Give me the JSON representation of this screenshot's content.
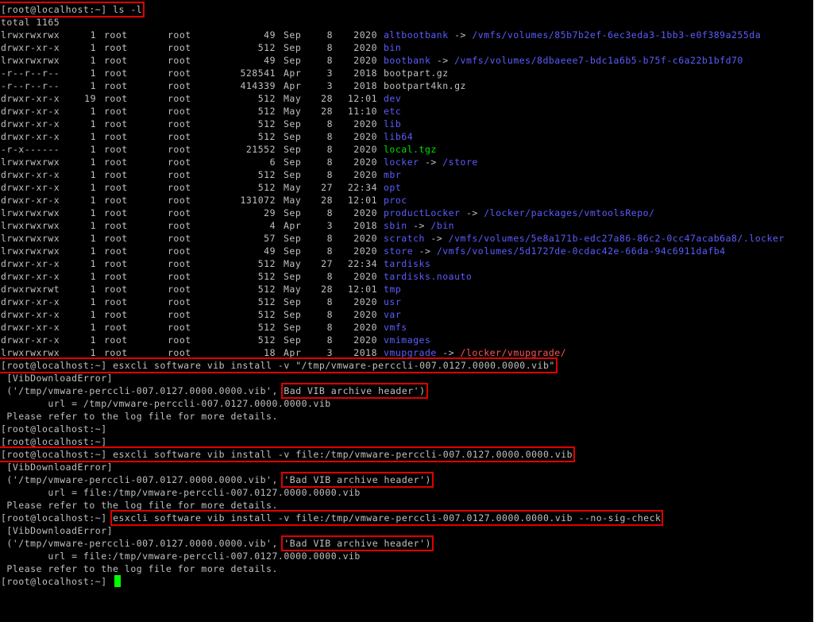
{
  "terminal": {
    "prompt": "[root@localhost:~]",
    "cmd_ls": "ls -l",
    "total": "total 1165",
    "listing": [
      {
        "perm": "lrwxrwxrwx",
        "links": "1",
        "owner": "root",
        "group": "root",
        "size": "49",
        "month": "Sep",
        "day": "8",
        "time": "2020",
        "name": "altbootbank",
        "kind": "link",
        "target": "/vmfs/volumes/85b7b2ef-6ec3eda3-1bb3-e0f389a255da",
        "target_kind": "dir"
      },
      {
        "perm": "drwxr-xr-x",
        "links": "1",
        "owner": "root",
        "group": "root",
        "size": "512",
        "month": "Sep",
        "day": "8",
        "time": "2020",
        "name": "bin",
        "kind": "dir",
        "target": "",
        "target_kind": ""
      },
      {
        "perm": "lrwxrwxrwx",
        "links": "1",
        "owner": "root",
        "group": "root",
        "size": "49",
        "month": "Sep",
        "day": "8",
        "time": "2020",
        "name": "bootbank",
        "kind": "link",
        "target": "/vmfs/volumes/8dbaeee7-bdc1a6b5-b75f-c6a22b1bfd70",
        "target_kind": "dir"
      },
      {
        "perm": "-r--r--r--",
        "links": "1",
        "owner": "root",
        "group": "root",
        "size": "528541",
        "month": "Apr",
        "day": "3",
        "time": "2018",
        "name": "bootpart.gz",
        "kind": "file",
        "target": "",
        "target_kind": ""
      },
      {
        "perm": "-r--r--r--",
        "links": "1",
        "owner": "root",
        "group": "root",
        "size": "414339",
        "month": "Apr",
        "day": "3",
        "time": "2018",
        "name": "bootpart4kn.gz",
        "kind": "file",
        "target": "",
        "target_kind": ""
      },
      {
        "perm": "drwxr-xr-x",
        "links": "19",
        "owner": "root",
        "group": "root",
        "size": "512",
        "month": "May",
        "day": "28",
        "time": "12:01",
        "name": "dev",
        "kind": "dir",
        "target": "",
        "target_kind": ""
      },
      {
        "perm": "drwxr-xr-x",
        "links": "1",
        "owner": "root",
        "group": "root",
        "size": "512",
        "month": "May",
        "day": "28",
        "time": "11:10",
        "name": "etc",
        "kind": "dir",
        "target": "",
        "target_kind": ""
      },
      {
        "perm": "drwxr-xr-x",
        "links": "1",
        "owner": "root",
        "group": "root",
        "size": "512",
        "month": "Sep",
        "day": "8",
        "time": "2020",
        "name": "lib",
        "kind": "dir",
        "target": "",
        "target_kind": ""
      },
      {
        "perm": "drwxr-xr-x",
        "links": "1",
        "owner": "root",
        "group": "root",
        "size": "512",
        "month": "Sep",
        "day": "8",
        "time": "2020",
        "name": "lib64",
        "kind": "dir",
        "target": "",
        "target_kind": ""
      },
      {
        "perm": "-r-x------",
        "links": "1",
        "owner": "root",
        "group": "root",
        "size": "21552",
        "month": "Sep",
        "day": "8",
        "time": "2020",
        "name": "local.tgz",
        "kind": "exec",
        "target": "",
        "target_kind": ""
      },
      {
        "perm": "lrwxrwxrwx",
        "links": "1",
        "owner": "root",
        "group": "root",
        "size": "6",
        "month": "Sep",
        "day": "8",
        "time": "2020",
        "name": "locker",
        "kind": "link",
        "target": "/store",
        "target_kind": "dir"
      },
      {
        "perm": "drwxr-xr-x",
        "links": "1",
        "owner": "root",
        "group": "root",
        "size": "512",
        "month": "Sep",
        "day": "8",
        "time": "2020",
        "name": "mbr",
        "kind": "dir",
        "target": "",
        "target_kind": ""
      },
      {
        "perm": "drwxr-xr-x",
        "links": "1",
        "owner": "root",
        "group": "root",
        "size": "512",
        "month": "May",
        "day": "27",
        "time": "22:34",
        "name": "opt",
        "kind": "dir",
        "target": "",
        "target_kind": ""
      },
      {
        "perm": "drwxr-xr-x",
        "links": "1",
        "owner": "root",
        "group": "root",
        "size": "131072",
        "month": "May",
        "day": "28",
        "time": "12:01",
        "name": "proc",
        "kind": "dir",
        "target": "",
        "target_kind": ""
      },
      {
        "perm": "lrwxrwxrwx",
        "links": "1",
        "owner": "root",
        "group": "root",
        "size": "29",
        "month": "Sep",
        "day": "8",
        "time": "2020",
        "name": "productLocker",
        "kind": "link",
        "target": "/locker/packages/vmtoolsRepo/",
        "target_kind": "dir"
      },
      {
        "perm": "lrwxrwxrwx",
        "links": "1",
        "owner": "root",
        "group": "root",
        "size": "4",
        "month": "Apr",
        "day": "3",
        "time": "2018",
        "name": "sbin",
        "kind": "link",
        "target": "/bin",
        "target_kind": "dir"
      },
      {
        "perm": "lrwxrwxrwx",
        "links": "1",
        "owner": "root",
        "group": "root",
        "size": "57",
        "month": "Sep",
        "day": "8",
        "time": "2020",
        "name": "scratch",
        "kind": "link",
        "target": "/vmfs/volumes/5e8a171b-edc27a86-86c2-0cc47acab6a8/.locker",
        "target_kind": "dir"
      },
      {
        "perm": "lrwxrwxrwx",
        "links": "1",
        "owner": "root",
        "group": "root",
        "size": "49",
        "month": "Sep",
        "day": "8",
        "time": "2020",
        "name": "store",
        "kind": "link",
        "target": "/vmfs/volumes/5d1727de-0cdac42e-66da-94c6911dafb4",
        "target_kind": "dir"
      },
      {
        "perm": "drwxr-xr-x",
        "links": "1",
        "owner": "root",
        "group": "root",
        "size": "512",
        "month": "May",
        "day": "27",
        "time": "22:34",
        "name": "tardisks",
        "kind": "dir",
        "target": "",
        "target_kind": ""
      },
      {
        "perm": "drwxr-xr-x",
        "links": "1",
        "owner": "root",
        "group": "root",
        "size": "512",
        "month": "Sep",
        "day": "8",
        "time": "2020",
        "name": "tardisks.noauto",
        "kind": "dir",
        "target": "",
        "target_kind": ""
      },
      {
        "perm": "drwxrwxrwt",
        "links": "1",
        "owner": "root",
        "group": "root",
        "size": "512",
        "month": "May",
        "day": "28",
        "time": "12:01",
        "name": "tmp",
        "kind": "dir",
        "target": "",
        "target_kind": ""
      },
      {
        "perm": "drwxr-xr-x",
        "links": "1",
        "owner": "root",
        "group": "root",
        "size": "512",
        "month": "Sep",
        "day": "8",
        "time": "2020",
        "name": "usr",
        "kind": "dir",
        "target": "",
        "target_kind": ""
      },
      {
        "perm": "drwxr-xr-x",
        "links": "1",
        "owner": "root",
        "group": "root",
        "size": "512",
        "month": "Sep",
        "day": "8",
        "time": "2020",
        "name": "var",
        "kind": "dir",
        "target": "",
        "target_kind": ""
      },
      {
        "perm": "drwxr-xr-x",
        "links": "1",
        "owner": "root",
        "group": "root",
        "size": "512",
        "month": "Sep",
        "day": "8",
        "time": "2020",
        "name": "vmfs",
        "kind": "dir",
        "target": "",
        "target_kind": ""
      },
      {
        "perm": "drwxr-xr-x",
        "links": "1",
        "owner": "root",
        "group": "root",
        "size": "512",
        "month": "Sep",
        "day": "8",
        "time": "2020",
        "name": "vmimages",
        "kind": "dir",
        "target": "",
        "target_kind": ""
      },
      {
        "perm": "lrwxrwxrwx",
        "links": "1",
        "owner": "root",
        "group": "root",
        "size": "18",
        "month": "Apr",
        "day": "3",
        "time": "2018",
        "name": "vmupgrade",
        "kind": "link",
        "target": "/locker/vmupgrade/",
        "target_kind": "broken"
      }
    ],
    "cmd1": "esxcli software vib install -v \"/tmp/vmware-perccli-007.0127.0000.0000.vib\"",
    "err1_header": " [VibDownloadError]",
    "err1_tuple_prefix": " ('/tmp/vmware-perccli-007.0127.0000.0000.vib', ",
    "err1_msg": "Bad VIB archive header')",
    "err1_url": "        url = /tmp/vmware-perccli-007.0127.0000.0000.vib",
    "err_refer": " Please refer to the log file for more details.",
    "cmd2": "esxcli software vib install -v file:/tmp/vmware-perccli-007.0127.0000.0000.vib",
    "err2_header": " [VibDownloadError]",
    "err2_tuple_prefix": " ('/tmp/vmware-perccli-007.0127.0000.0000.vib', ",
    "err2_msg": "'Bad VIB archive header')",
    "err2_url": "        url = file:/tmp/vmware-perccli-007.0127.0000.0000.vib",
    "cmd3": "esxcli software vib install -v file:/tmp/vmware-perccli-007.0127.0000.0000.vib --no-sig-check",
    "err3_header": " [VibDownloadError]",
    "err3_tuple_prefix": " ('/tmp/vmware-perccli-007.0127.0000.0000.vib', ",
    "err3_msg": "'Bad VIB archive header')",
    "err3_url": "        url = file:/tmp/vmware-perccli-007.0127.0000.0000.vib",
    "arrow": " -> ",
    "colors": {
      "background": "#000000",
      "text": "#c0c0c0",
      "dir": "#5c5cff",
      "exec": "#00e000",
      "broken_link": "#ff5555",
      "highlight_box": "#e00000",
      "cursor": "#00ff00"
    }
  }
}
